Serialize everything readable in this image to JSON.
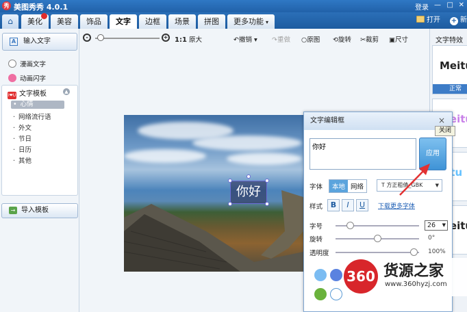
{
  "app": {
    "title": "美图秀秀 4.0.1",
    "logo_text": "秀",
    "login": "登录",
    "win_min": "—",
    "win_max": "□",
    "win_close": "✕"
  },
  "tabs": [
    {
      "label": "美化",
      "badge": true
    },
    {
      "label": "美容"
    },
    {
      "label": "饰品"
    },
    {
      "label": "文字",
      "active": true
    },
    {
      "label": "边框"
    },
    {
      "label": "场景"
    },
    {
      "label": "拼图"
    },
    {
      "label": "更多功能",
      "dropdown": true
    }
  ],
  "home_icon": "⌂",
  "right_actions": {
    "open": "打开",
    "new": "新"
  },
  "left_panel": {
    "input_text": "输入文字",
    "input_icon": "A",
    "comic_text": "漫画文字",
    "animated_text": "动画闪字",
    "template_header": "文字模板",
    "template_icon": "I❤U",
    "categories": [
      "心情",
      "网络流行语",
      "外文",
      "节日",
      "日历",
      "其他"
    ],
    "selected_category": "心情",
    "import_template": "导入模板"
  },
  "toolbar": {
    "zoom_out": "-",
    "zoom_in": "+",
    "ratio": "1:1",
    "original_size": "原大",
    "undo": "撤销",
    "redo": "重做",
    "original_image": "原图",
    "rotate": "旋转",
    "crop": "裁剪",
    "size": "尺寸",
    "zoom_level": 0.05
  },
  "canvas": {
    "sticker_text": "你好"
  },
  "dialog": {
    "title": "文字编辑框",
    "close": "×",
    "tooltip": "关闭",
    "text_value": "你好",
    "apply": "应用",
    "font_label": "字体",
    "font_local": "本地",
    "font_network": "网络",
    "font_name": "方正粗倩_GBK",
    "style_label": "样式",
    "bold": "B",
    "italic": "I",
    "underline": "U",
    "more_fonts": "下载更多字体",
    "size_label": "字号",
    "size_value": "26",
    "rotate_label": "旋转",
    "rotate_value": "0°",
    "opacity_label": "透明度",
    "opacity_value": "100%",
    "size_slider": 0.14,
    "rotate_slider": 0.5,
    "opacity_slider": 0.98,
    "swatches": [
      "#7bbcf2",
      "#5a82e0",
      "#6ab23c",
      "#ffffff"
    ]
  },
  "right_panel": {
    "header": "文字特效",
    "effects": [
      {
        "text": "Meitu",
        "label": "正常",
        "color": "#222"
      },
      {
        "text": "Meitu",
        "color": "#c880e8"
      },
      {
        "text": "eitu",
        "color": "#66c2ff"
      },
      {
        "text": "Meitu",
        "color": "#222"
      }
    ]
  },
  "watermark": {
    "circle": "360",
    "name": "货源之家",
    "url": "www.360hyzj.com"
  },
  "colors": {
    "titlebar": "#2161a9",
    "accent": "#3d7cc7",
    "apply": "#3f93d6",
    "arrow": "#e23232"
  }
}
